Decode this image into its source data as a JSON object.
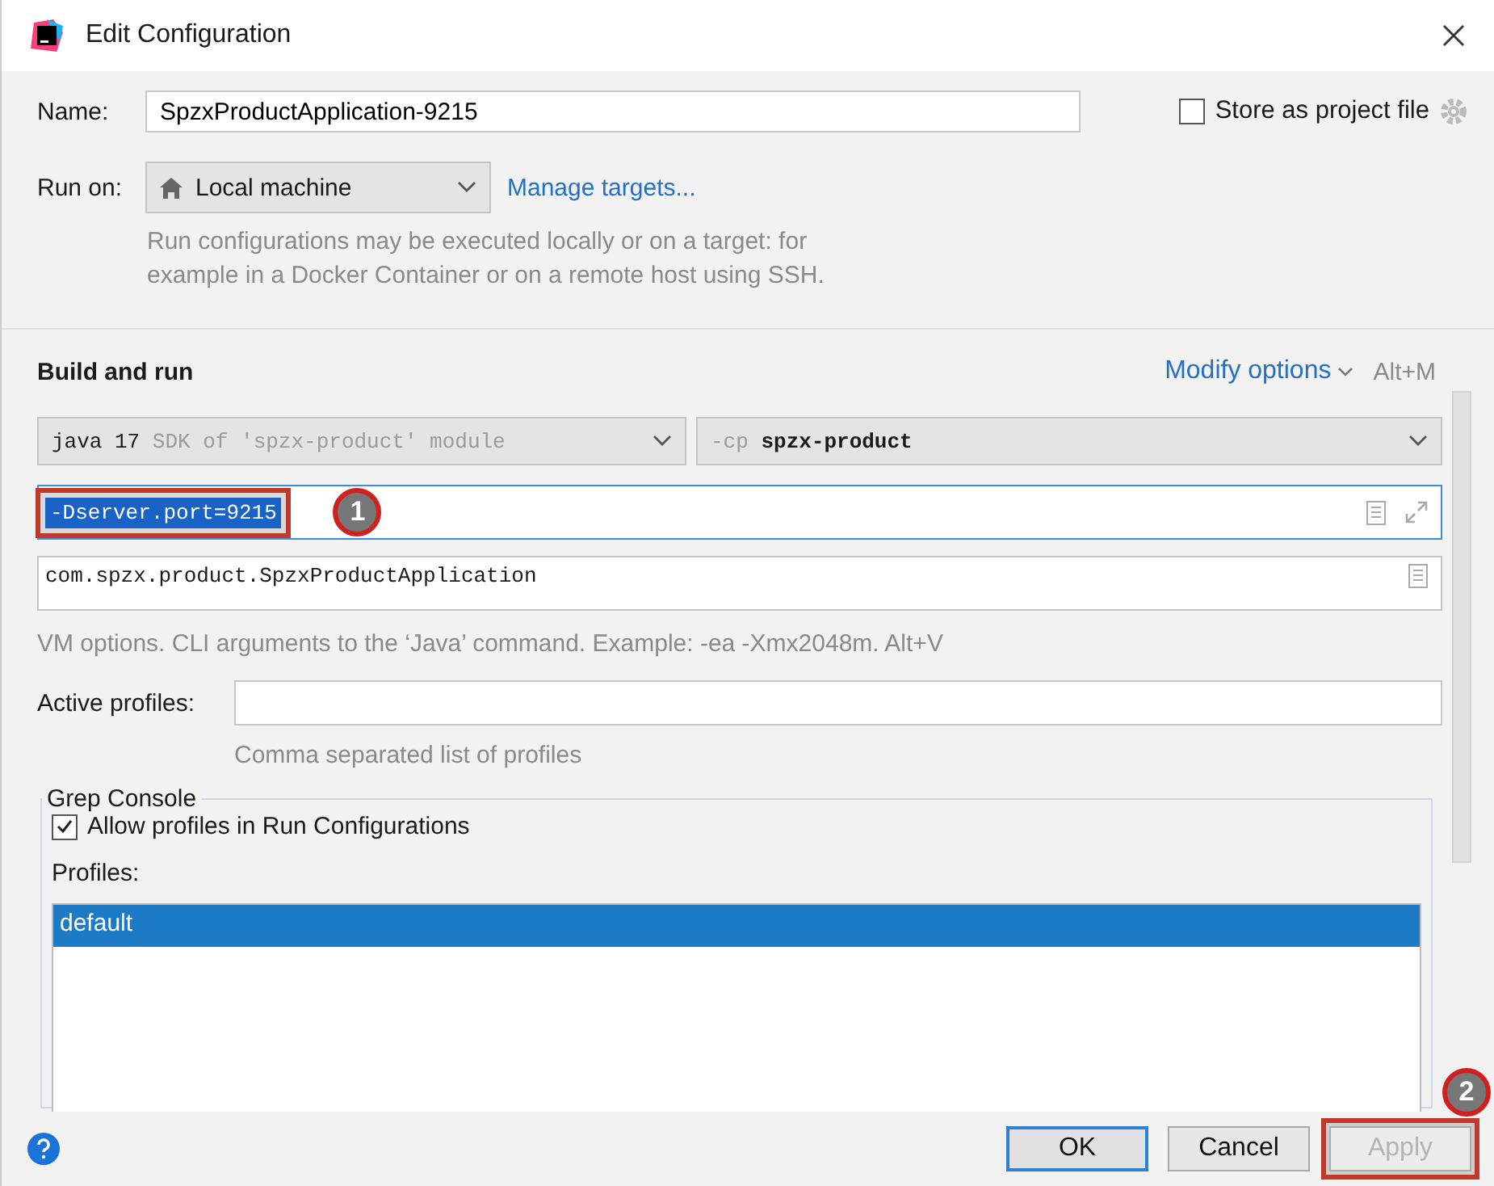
{
  "window": {
    "title": "Edit Configuration"
  },
  "name_field": {
    "label": "Name:",
    "value": "SpzxProductApplication-9215"
  },
  "store_as_project_file": {
    "label": "Store as project file",
    "checked": false
  },
  "run_on": {
    "label": "Run on:",
    "value": "Local machine",
    "link": "Manage targets...",
    "hint": "Run configurations may be executed locally or on a target: for example in a Docker Container or on a remote host using SSH."
  },
  "build_and_run": {
    "title": "Build and run",
    "modify_options": "Modify options",
    "shortcut": "Alt+M",
    "jdk": {
      "version": "java 17",
      "hint": "SDK of 'spzx-product' module"
    },
    "classpath": {
      "prefix": "-cp",
      "value": "spzx-product"
    },
    "vm_options": {
      "value": "-Dserver.port=9215",
      "selected": true,
      "highlighted": true,
      "callout": "1"
    },
    "main_class": "com.spzx.product.SpzxProductApplication",
    "hint": "VM options. CLI arguments to the ‘Java’ command. Example: -ea -Xmx2048m. Alt+V"
  },
  "active_profiles": {
    "label": "Active profiles:",
    "hint": "Comma separated list of profiles"
  },
  "grep_console": {
    "title": "Grep Console",
    "allow_profiles": {
      "label": "Allow profiles in Run Configurations",
      "checked": true
    },
    "profiles_label": "Profiles:",
    "profiles": [
      {
        "label": "default",
        "selected": true
      }
    ]
  },
  "buttons": [
    {
      "label": "OK",
      "kind": "default",
      "disabled": false,
      "highlighted": false
    },
    {
      "label": "Cancel",
      "kind": "normal",
      "disabled": false,
      "highlighted": false
    },
    {
      "label": "Apply",
      "kind": "normal",
      "disabled": true,
      "highlighted": true,
      "callout": "2"
    }
  ]
}
